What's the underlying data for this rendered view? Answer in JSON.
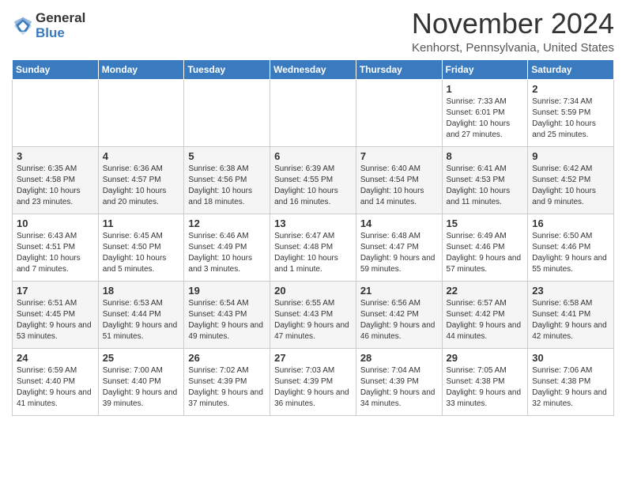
{
  "logo": {
    "general": "General",
    "blue": "Blue"
  },
  "header": {
    "month": "November 2024",
    "location": "Kenhorst, Pennsylvania, United States"
  },
  "weekdays": [
    "Sunday",
    "Monday",
    "Tuesday",
    "Wednesday",
    "Thursday",
    "Friday",
    "Saturday"
  ],
  "weeks": [
    [
      {
        "day": "",
        "info": ""
      },
      {
        "day": "",
        "info": ""
      },
      {
        "day": "",
        "info": ""
      },
      {
        "day": "",
        "info": ""
      },
      {
        "day": "",
        "info": ""
      },
      {
        "day": "1",
        "info": "Sunrise: 7:33 AM\nSunset: 6:01 PM\nDaylight: 10 hours and 27 minutes."
      },
      {
        "day": "2",
        "info": "Sunrise: 7:34 AM\nSunset: 5:59 PM\nDaylight: 10 hours and 25 minutes."
      }
    ],
    [
      {
        "day": "3",
        "info": "Sunrise: 6:35 AM\nSunset: 4:58 PM\nDaylight: 10 hours and 23 minutes."
      },
      {
        "day": "4",
        "info": "Sunrise: 6:36 AM\nSunset: 4:57 PM\nDaylight: 10 hours and 20 minutes."
      },
      {
        "day": "5",
        "info": "Sunrise: 6:38 AM\nSunset: 4:56 PM\nDaylight: 10 hours and 18 minutes."
      },
      {
        "day": "6",
        "info": "Sunrise: 6:39 AM\nSunset: 4:55 PM\nDaylight: 10 hours and 16 minutes."
      },
      {
        "day": "7",
        "info": "Sunrise: 6:40 AM\nSunset: 4:54 PM\nDaylight: 10 hours and 14 minutes."
      },
      {
        "day": "8",
        "info": "Sunrise: 6:41 AM\nSunset: 4:53 PM\nDaylight: 10 hours and 11 minutes."
      },
      {
        "day": "9",
        "info": "Sunrise: 6:42 AM\nSunset: 4:52 PM\nDaylight: 10 hours and 9 minutes."
      }
    ],
    [
      {
        "day": "10",
        "info": "Sunrise: 6:43 AM\nSunset: 4:51 PM\nDaylight: 10 hours and 7 minutes."
      },
      {
        "day": "11",
        "info": "Sunrise: 6:45 AM\nSunset: 4:50 PM\nDaylight: 10 hours and 5 minutes."
      },
      {
        "day": "12",
        "info": "Sunrise: 6:46 AM\nSunset: 4:49 PM\nDaylight: 10 hours and 3 minutes."
      },
      {
        "day": "13",
        "info": "Sunrise: 6:47 AM\nSunset: 4:48 PM\nDaylight: 10 hours and 1 minute."
      },
      {
        "day": "14",
        "info": "Sunrise: 6:48 AM\nSunset: 4:47 PM\nDaylight: 9 hours and 59 minutes."
      },
      {
        "day": "15",
        "info": "Sunrise: 6:49 AM\nSunset: 4:46 PM\nDaylight: 9 hours and 57 minutes."
      },
      {
        "day": "16",
        "info": "Sunrise: 6:50 AM\nSunset: 4:46 PM\nDaylight: 9 hours and 55 minutes."
      }
    ],
    [
      {
        "day": "17",
        "info": "Sunrise: 6:51 AM\nSunset: 4:45 PM\nDaylight: 9 hours and 53 minutes."
      },
      {
        "day": "18",
        "info": "Sunrise: 6:53 AM\nSunset: 4:44 PM\nDaylight: 9 hours and 51 minutes."
      },
      {
        "day": "19",
        "info": "Sunrise: 6:54 AM\nSunset: 4:43 PM\nDaylight: 9 hours and 49 minutes."
      },
      {
        "day": "20",
        "info": "Sunrise: 6:55 AM\nSunset: 4:43 PM\nDaylight: 9 hours and 47 minutes."
      },
      {
        "day": "21",
        "info": "Sunrise: 6:56 AM\nSunset: 4:42 PM\nDaylight: 9 hours and 46 minutes."
      },
      {
        "day": "22",
        "info": "Sunrise: 6:57 AM\nSunset: 4:42 PM\nDaylight: 9 hours and 44 minutes."
      },
      {
        "day": "23",
        "info": "Sunrise: 6:58 AM\nSunset: 4:41 PM\nDaylight: 9 hours and 42 minutes."
      }
    ],
    [
      {
        "day": "24",
        "info": "Sunrise: 6:59 AM\nSunset: 4:40 PM\nDaylight: 9 hours and 41 minutes."
      },
      {
        "day": "25",
        "info": "Sunrise: 7:00 AM\nSunset: 4:40 PM\nDaylight: 9 hours and 39 minutes."
      },
      {
        "day": "26",
        "info": "Sunrise: 7:02 AM\nSunset: 4:39 PM\nDaylight: 9 hours and 37 minutes."
      },
      {
        "day": "27",
        "info": "Sunrise: 7:03 AM\nSunset: 4:39 PM\nDaylight: 9 hours and 36 minutes."
      },
      {
        "day": "28",
        "info": "Sunrise: 7:04 AM\nSunset: 4:39 PM\nDaylight: 9 hours and 34 minutes."
      },
      {
        "day": "29",
        "info": "Sunrise: 7:05 AM\nSunset: 4:38 PM\nDaylight: 9 hours and 33 minutes."
      },
      {
        "day": "30",
        "info": "Sunrise: 7:06 AM\nSunset: 4:38 PM\nDaylight: 9 hours and 32 minutes."
      }
    ]
  ]
}
